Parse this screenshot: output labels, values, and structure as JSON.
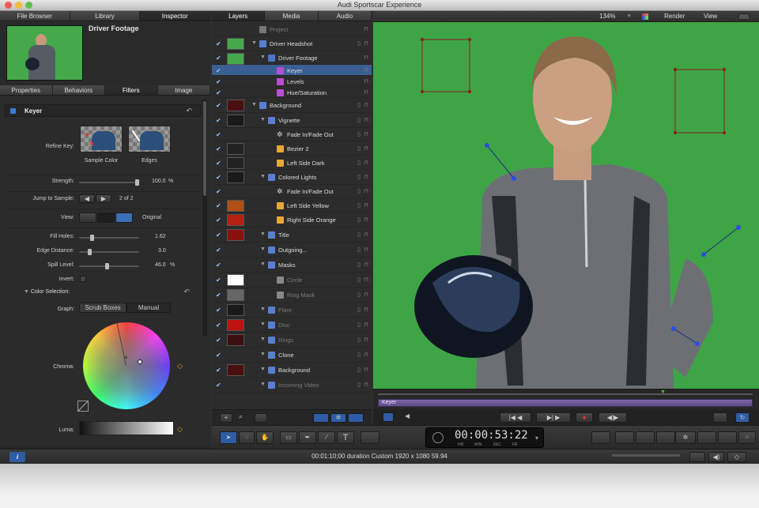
{
  "window": {
    "title": "Audi Sportscar Experience"
  },
  "left_tabs": [
    "File Browser",
    "Library",
    "Inspector"
  ],
  "clip": {
    "name": "Driver Footage"
  },
  "inspector_tabs": [
    "Properties",
    "Behaviors",
    "Filters",
    "Image"
  ],
  "filter": {
    "name": "Keyer",
    "refine_key_label": "Refine Key:",
    "sample_color_label": "Sample Color",
    "edges_label": "Edges",
    "strength_label": "Strength:",
    "strength_value": "100.0",
    "strength_unit": "%",
    "strength_fraction": 1.0,
    "jump_label": "Jump to Sample:",
    "jump_value": "2 of 2",
    "view_label": "View:",
    "view_value": "Original",
    "fill_holes_label": "Fill Holes:",
    "fill_holes_value": "1.62",
    "fill_holes_fraction": 0.2,
    "edge_distance_label": "Edge Distance:",
    "edge_distance_value": "3.0",
    "edge_distance_fraction": 0.15,
    "spill_label": "Spill Level:",
    "spill_value": "46.0",
    "spill_unit": "%",
    "spill_fraction": 0.46,
    "invert_label": "Invert:",
    "color_selection_label": "Color Selection:",
    "graph_label": "Graph:",
    "graph_options": [
      "Scrub Boxes",
      "Manual"
    ],
    "chroma_label": "Chroma:",
    "luma_label": "Luma:"
  },
  "layers_tabs": [
    "Layers",
    "Media",
    "Audio"
  ],
  "layers": [
    {
      "name": "Project",
      "dim": true
    },
    {
      "name": "Driver Headshot",
      "dim": false
    },
    {
      "name": "Driver Footage",
      "dim": false
    },
    {
      "name": "Keyer",
      "dim": false
    },
    {
      "name": "Levels",
      "dim": false
    },
    {
      "name": "Hue/Saturation",
      "dim": false
    },
    {
      "name": "Background",
      "dim": false
    },
    {
      "name": "Vignette",
      "dim": false
    },
    {
      "name": "Fade In/Fade Out",
      "dim": false
    },
    {
      "name": "Bezier 2",
      "dim": false
    },
    {
      "name": "Left Side Dark",
      "dim": false
    },
    {
      "name": "Colored Lights",
      "dim": false
    },
    {
      "name": "Fade In/Fade Out",
      "dim": false
    },
    {
      "name": "Left Side Yellow",
      "dim": false
    },
    {
      "name": "Right Side Orange",
      "dim": false
    },
    {
      "name": "Title",
      "dim": false
    },
    {
      "name": "Outgoing...",
      "dim": false
    },
    {
      "name": "Masks",
      "dim": false
    },
    {
      "name": "Circle",
      "dim": true
    },
    {
      "name": "Ring Mask",
      "dim": true
    },
    {
      "name": "Flare",
      "dim": true
    },
    {
      "name": "Disc",
      "dim": true
    },
    {
      "name": "Rings",
      "dim": true
    },
    {
      "name": "Clone",
      "dim": false
    },
    {
      "name": "Background",
      "dim": false
    },
    {
      "name": "Incoming Video",
      "dim": true
    }
  ],
  "canvas_toolbar": {
    "zoom": "134%",
    "render": "Render",
    "view": "View"
  },
  "timeline": {
    "bar_label": "Keyer",
    "playhead_fraction": 0.76
  },
  "timecode": {
    "value": "00:00:53:22",
    "units": [
      "HR",
      "MIN",
      "SEC",
      "FR"
    ]
  },
  "status_bar": {
    "text": "00:01:10;00 duration Custom 1920 x 1080 59.94"
  },
  "colors": {
    "canvas_green": "#3ea547",
    "selection": "#3b5f93",
    "accent": "#4a8cff"
  },
  "icons": [
    "info-icon",
    "arrow-tool-icon",
    "hand-icon",
    "text-tool-icon",
    "gear-icon",
    "lock-icon"
  ]
}
